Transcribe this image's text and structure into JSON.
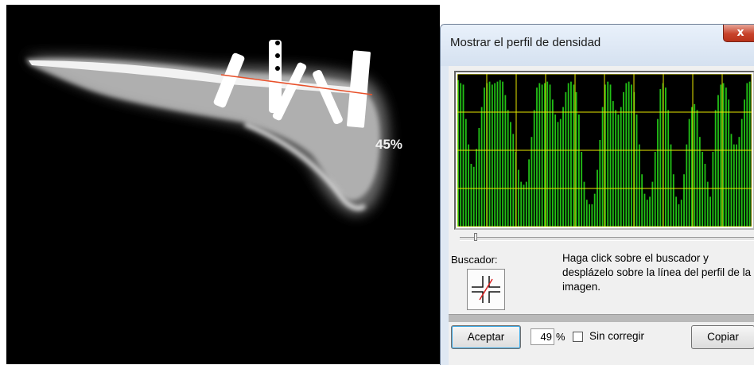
{
  "xray": {
    "overlay_label": "45%"
  },
  "dialog": {
    "title": "Mostrar el perfil de densidad",
    "close_label": "x",
    "finder_label": "Buscador:",
    "help_text": "Haga click sobre el buscador y desplázelo sobre la línea del perfil de la imagen.",
    "accept_label": "Aceptar",
    "percent_value": "49",
    "percent_sign": "%",
    "uncorrected_label": "Sin corregir",
    "copy_label": "Copiar"
  },
  "colors": {
    "graph_bars": "#22c016",
    "graph_background": "#000000",
    "graph_grid": "#e8e800",
    "profile_line": "#e8502a",
    "close_button": "#c8432b"
  },
  "profile": {
    "bars": [
      0.98,
      0.96,
      0.95,
      0.72,
      0.55,
      0.42,
      0.4,
      0.52,
      0.66,
      0.8,
      0.93,
      0.96,
      0.97,
      0.95,
      0.96,
      0.97,
      0.98,
      0.97,
      0.88,
      0.78,
      0.7,
      0.62,
      0.5,
      0.38,
      0.3,
      0.28,
      0.3,
      0.45,
      0.6,
      0.78,
      0.93,
      0.96,
      0.95,
      0.96,
      0.97,
      0.95,
      0.85,
      0.75,
      0.7,
      0.72,
      0.8,
      0.9,
      0.96,
      0.97,
      0.95,
      0.9,
      0.75,
      0.5,
      0.3,
      0.18,
      0.15,
      0.15,
      0.22,
      0.38,
      0.58,
      0.8,
      0.95,
      0.97,
      0.95,
      0.84,
      0.78,
      0.75,
      0.8,
      0.9,
      0.96,
      0.97,
      0.95,
      0.9,
      0.75,
      0.55,
      0.35,
      0.22,
      0.18,
      0.2,
      0.3,
      0.5,
      0.72,
      0.92,
      0.96,
      0.93,
      0.78,
      0.55,
      0.35,
      0.2,
      0.15,
      0.18,
      0.35,
      0.55,
      0.72,
      0.8,
      0.82,
      0.78,
      0.6,
      0.5,
      0.42,
      0.3,
      0.2,
      0.5,
      0.78,
      0.88,
      0.95,
      0.96,
      0.93,
      0.85,
      0.62,
      0.55,
      0.55,
      0.6,
      0.72,
      0.85,
      0.96,
      0.97
    ]
  }
}
